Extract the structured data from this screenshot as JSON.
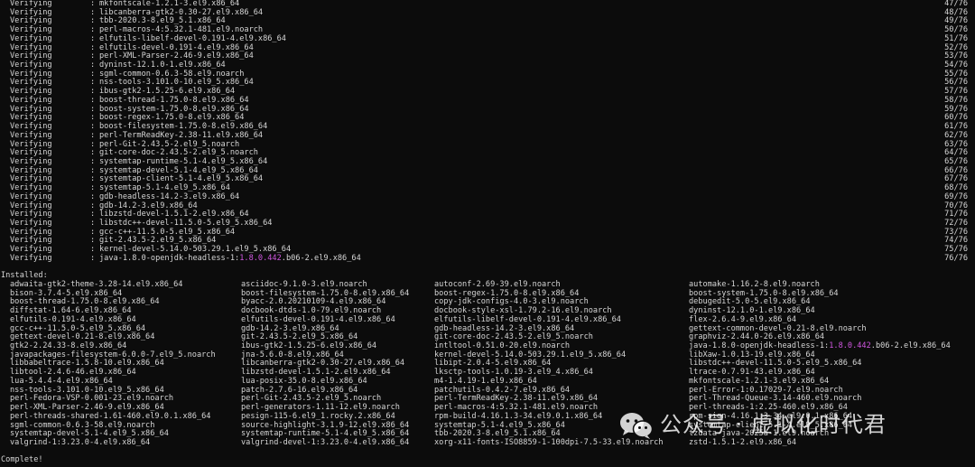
{
  "verify_rows": [
    {
      "status": "Verifying",
      "pkg": "mkfontscale-1.2.1-3.el9.x86_64",
      "count": "47/76"
    },
    {
      "status": "Verifying",
      "pkg": "libcanberra-gtk2-0.30-27.el9.x86_64",
      "count": "48/76"
    },
    {
      "status": "Verifying",
      "pkg": "tbb-2020.3-8.el9_5.1.x86_64",
      "count": "49/76"
    },
    {
      "status": "Verifying",
      "pkg": "perl-macros-4:5.32.1-481.el9.noarch",
      "count": "50/76"
    },
    {
      "status": "Verifying",
      "pkg": "elfutils-libelf-devel-0.191-4.el9.x86_64",
      "count": "51/76"
    },
    {
      "status": "Verifying",
      "pkg": "elfutils-devel-0.191-4.el9.x86_64",
      "count": "52/76"
    },
    {
      "status": "Verifying",
      "pkg": "perl-XML-Parser-2.46-9.el9.x86_64",
      "count": "53/76"
    },
    {
      "status": "Verifying",
      "pkg": "dyninst-12.1.0-1.el9.x86_64",
      "count": "54/76"
    },
    {
      "status": "Verifying",
      "pkg": "sgml-common-0.6.3-58.el9.noarch",
      "count": "55/76"
    },
    {
      "status": "Verifying",
      "pkg": "nss-tools-3.101.0-10.el9_5.x86_64",
      "count": "56/76"
    },
    {
      "status": "Verifying",
      "pkg": "ibus-gtk2-1.5.25-6.el9.x86_64",
      "count": "57/76"
    },
    {
      "status": "Verifying",
      "pkg": "boost-thread-1.75.0-8.el9.x86_64",
      "count": "58/76"
    },
    {
      "status": "Verifying",
      "pkg": "boost-system-1.75.0-8.el9.x86_64",
      "count": "59/76"
    },
    {
      "status": "Verifying",
      "pkg": "boost-regex-1.75.0-8.el9.x86_64",
      "count": "60/76"
    },
    {
      "status": "Verifying",
      "pkg": "boost-filesystem-1.75.0-8.el9.x86_64",
      "count": "61/76"
    },
    {
      "status": "Verifying",
      "pkg": "perl-TermReadKey-2.38-11.el9.x86_64",
      "count": "62/76"
    },
    {
      "status": "Verifying",
      "pkg": "perl-Git-2.43.5-2.el9_5.noarch",
      "count": "63/76"
    },
    {
      "status": "Verifying",
      "pkg": "git-core-doc-2.43.5-2.el9_5.noarch",
      "count": "64/76"
    },
    {
      "status": "Verifying",
      "pkg": "systemtap-runtime-5.1-4.el9_5.x86_64",
      "count": "65/76"
    },
    {
      "status": "Verifying",
      "pkg": "systemtap-devel-5.1-4.el9_5.x86_64",
      "count": "66/76"
    },
    {
      "status": "Verifying",
      "pkg": "systemtap-client-5.1-4.el9_5.x86_64",
      "count": "67/76"
    },
    {
      "status": "Verifying",
      "pkg": "systemtap-5.1-4.el9_5.x86_64",
      "count": "68/76"
    },
    {
      "status": "Verifying",
      "pkg": "gdb-headless-14.2-3.el9.x86_64",
      "count": "69/76"
    },
    {
      "status": "Verifying",
      "pkg": "gdb-14.2-3.el9.x86_64",
      "count": "70/76"
    },
    {
      "status": "Verifying",
      "pkg": "libzstd-devel-1.5.1-2.el9.x86_64",
      "count": "71/76"
    },
    {
      "status": "Verifying",
      "pkg": "libstdc++-devel-11.5.0-5.el9_5.x86_64",
      "count": "72/76"
    },
    {
      "status": "Verifying",
      "pkg": "gcc-c++-11.5.0-5.el9_5.x86_64",
      "count": "73/76"
    },
    {
      "status": "Verifying",
      "pkg": "git-2.43.5-2.el9_5.x86_64",
      "count": "74/76"
    },
    {
      "status": "Verifying",
      "pkg": "kernel-devel-5.14.0-503.29.1.el9_5.x86_64",
      "count": "75/76"
    },
    {
      "status": "Verifying",
      "pkg": "java-1.8.0-openjdk-headless-1:",
      "pkg_hl": "1.8.0.442",
      "pkg_tail": ".b06-2.el9.x86_64",
      "count": "76/76"
    }
  ],
  "installed_header": "Installed:",
  "installed_rows": [
    [
      "adwaita-gtk2-theme-3.28-14.el9.x86_64",
      "asciidoc-9.1.0-3.el9.noarch",
      "autoconf-2.69-39.el9.noarch",
      "automake-1.16.2-8.el9.noarch"
    ],
    [
      "bison-3.7.4-5.el9.x86_64",
      "boost-filesystem-1.75.0-8.el9.x86_64",
      "boost-regex-1.75.0-8.el9.x86_64",
      "boost-system-1.75.0-8.el9.x86_64"
    ],
    [
      "boost-thread-1.75.0-8.el9.x86_64",
      "byacc-2.0.20210109-4.el9.x86_64",
      "copy-jdk-configs-4.0-3.el9.noarch",
      "debugedit-5.0-5.el9.x86_64"
    ],
    [
      "diffstat-1.64-6.el9.x86_64",
      "docbook-dtds-1.0-79.el9.noarch",
      "docbook-style-xsl-1.79.2-16.el9.noarch",
      "dyninst-12.1.0-1.el9.x86_64"
    ],
    [
      "elfutils-0.191-4.el9.x86_64",
      "elfutils-devel-0.191-4.el9.x86_64",
      "elfutils-libelf-devel-0.191-4.el9.x86_64",
      "flex-2.6.4-9.el9.x86_64"
    ],
    [
      "gcc-c++-11.5.0-5.el9_5.x86_64",
      "gdb-14.2-3.el9.x86_64",
      "gdb-headless-14.2-3.el9.x86_64",
      "gettext-common-devel-0.21-8.el9.noarch"
    ],
    [
      "gettext-devel-0.21-8.el9.x86_64",
      "git-2.43.5-2.el9_5.x86_64",
      "git-core-doc-2.43.5-2.el9_5.noarch",
      "graphviz-2.44.0-26.el9.x86_64"
    ],
    [
      "gtk2-2.24.33-8.el9.x86_64",
      "ibus-gtk2-1.5.25-6.el9.x86_64",
      "intltool-0.51.0-20.el9.noarch",
      "java-1.8.0-openjdk-headless-1:1.8.0.442.b06-2.el9.x86_64"
    ],
    [
      "javapackages-filesystem-6.0.0-7.el9_5.noarch",
      "jna-5.6.0-8.el9.x86_64",
      "kernel-devel-5.14.0-503.29.1.el9_5.x86_64",
      "libXaw-1.0.13-19.el9.x86_64"
    ],
    [
      "libbabeltrace-1.5.8-10.el9.x86_64",
      "libcanberra-gtk2-0.30-27.el9.x86_64",
      "libipt-2.0.4-5.el9.x86_64",
      "libstdc++-devel-11.5.0-5.el9_5.x86_64"
    ],
    [
      "libtool-2.4.6-46.el9.x86_64",
      "libzstd-devel-1.5.1-2.el9.x86_64",
      "lksctp-tools-1.0.19-3.el9_4.x86_64",
      "ltrace-0.7.91-43.el9.x86_64"
    ],
    [
      "lua-5.4.4-4.el9.x86_64",
      "lua-posix-35.0-8.el9.x86_64",
      "m4-1.4.19-1.el9.x86_64",
      "mkfontscale-1.2.1-3.el9.x86_64"
    ],
    [
      "nss-tools-3.101.0-10.el9_5.x86_64",
      "patch-2.7.6-16.el9.x86_64",
      "patchutils-0.4.2-7.el9.x86_64",
      "perl-Error-1:0.17029-7.el9.noarch"
    ],
    [
      "perl-Fedora-VSP-0.001-23.el9.noarch",
      "perl-Git-2.43.5-2.el9_5.noarch",
      "perl-TermReadKey-2.38-11.el9.x86_64",
      "perl-Thread-Queue-3.14-460.el9.noarch"
    ],
    [
      "perl-XML-Parser-2.46-9.el9.x86_64",
      "perl-generators-1.11-12.el9.noarch",
      "perl-macros-4:5.32.1-481.el9.noarch",
      "perl-threads-1:2.25-460.el9.x86_64"
    ],
    [
      "perl-threads-shared-1.61-460.el9.0.1.x86_64",
      "pesign-115-6.el9_1.rocky.2.x86_64",
      "rpm-build-4.16.1.3-34.el9.0.1.x86_64",
      "rpm-sign-4.16.1.3-34.el9.0.1.x86_64"
    ],
    [
      "sgml-common-0.6.3-58.el9.noarch",
      "source-highlight-3.1.9-12.el9.x86_64",
      "systemtap-5.1-4.el9_5.x86_64",
      "systemtap-client-5.1-4.el9_5.x86_64"
    ],
    [
      "systemtap-devel-5.1-4.el9_5.x86_64",
      "systemtap-runtime-5.1-4.el9_5.x86_64",
      "tbb-2020.3-8.el9_5.1.x86_64",
      "tzdata-java-2025a-1.el9.noarch"
    ],
    [
      "valgrind-1:3.23.0-4.el9.x86_64",
      "valgrind-devel-1:3.23.0-4.el9.x86_64",
      "xorg-x11-fonts-ISO8859-1-100dpi-7.5-33.el9.noarch",
      "zstd-1.5.1-2.el9.x86_64"
    ]
  ],
  "complete_text": "Complete!",
  "watermark": {
    "text": "公众号 · 虚拟化时代君",
    "icon": "wechat-icon"
  },
  "colors": {
    "background": "#0c0c0c",
    "text": "#d6d6d6",
    "highlight": "#d056e0"
  }
}
